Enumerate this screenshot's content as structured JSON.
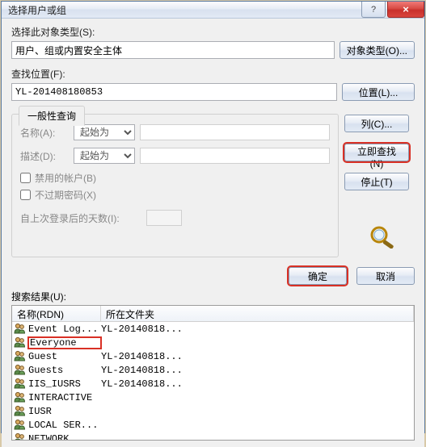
{
  "window": {
    "title": "选择用户或组"
  },
  "titlebar_buttons": {
    "help": "?",
    "close": "×"
  },
  "object_type": {
    "label": "选择此对象类型(S):",
    "value": "用户、组或内置安全主体",
    "button": "对象类型(O)..."
  },
  "location": {
    "label": "查找位置(F):",
    "value": "YL-201408180853",
    "button": "位置(L)..."
  },
  "tab": {
    "label": "一般性查询"
  },
  "criteria": {
    "name_label": "名称(A):",
    "name_mode": "起始为",
    "desc_label": "描述(D):",
    "desc_mode": "起始为",
    "disabled_accounts": "禁用的帐户(B)",
    "never_expire": "不过期密码(X)",
    "days_label": "自上次登录后的天数(I):"
  },
  "right_buttons": {
    "columns": "列(C)...",
    "find_now": "立即查找(N)",
    "stop": "停止(T)"
  },
  "actions": {
    "ok": "确定",
    "cancel": "取消"
  },
  "results": {
    "label": "搜索结果(U):",
    "col_name": "名称(RDN)",
    "col_folder": "所在文件夹",
    "rows": [
      {
        "name": "Event Log...",
        "folder": "YL-20140818..."
      },
      {
        "name": "Everyone",
        "folder": ""
      },
      {
        "name": "Guest",
        "folder": "YL-20140818..."
      },
      {
        "name": "Guests",
        "folder": "YL-20140818..."
      },
      {
        "name": "IIS_IUSRS",
        "folder": "YL-20140818..."
      },
      {
        "name": "INTERACTIVE",
        "folder": ""
      },
      {
        "name": "IUSR",
        "folder": ""
      },
      {
        "name": "LOCAL SER...",
        "folder": ""
      },
      {
        "name": "NETWORK",
        "folder": ""
      }
    ]
  }
}
